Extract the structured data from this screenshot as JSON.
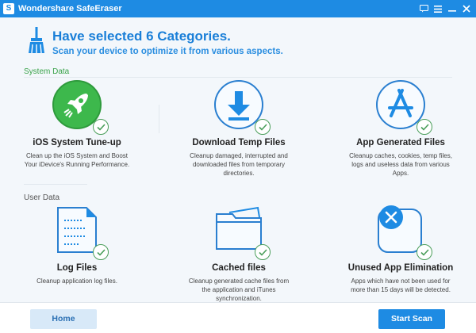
{
  "window": {
    "app_logo": "S",
    "title": "Wondershare SafeEraser",
    "controls": [
      "feedback-icon",
      "menu-icon",
      "minimize-icon",
      "close-icon"
    ]
  },
  "header": {
    "title": "Have selected 6 Categories.",
    "subtitle": "Scan your device to optimize it from various aspects."
  },
  "sections": {
    "system": "System Data",
    "user": "User Data"
  },
  "cards": [
    {
      "name": "iOS System Tune-up",
      "desc": "Clean up the iOS System and Boost Your iDevice's Running Performance.",
      "icon": "rocket-icon",
      "selected": true
    },
    {
      "name": "Download Temp Files",
      "desc": "Cleanup damaged, interrupted and downloaded files from temporary directories.",
      "icon": "download-icon",
      "selected": true
    },
    {
      "name": "App Generated Files",
      "desc": "Cleanup caches, cookies, temp files, logs and useless data from various Apps.",
      "icon": "app-store-icon",
      "selected": true
    },
    {
      "name": "Log Files",
      "desc": "Cleanup application log files.",
      "icon": "document-icon",
      "selected": true
    },
    {
      "name": "Cached files",
      "desc": "Cleanup generated cache files from the application and iTunes synchronization.",
      "icon": "folder-icon",
      "selected": true
    },
    {
      "name": "Unused App Elimination",
      "desc": "Apps which have not been used for more than 15 days will be detected.",
      "icon": "app-remove-icon",
      "selected": true
    }
  ],
  "footer": {
    "home": "Home",
    "start": "Start Scan"
  },
  "colors": {
    "accent": "#1e8be3",
    "system_label": "#3aa34a",
    "check": "#4a9e5a"
  }
}
